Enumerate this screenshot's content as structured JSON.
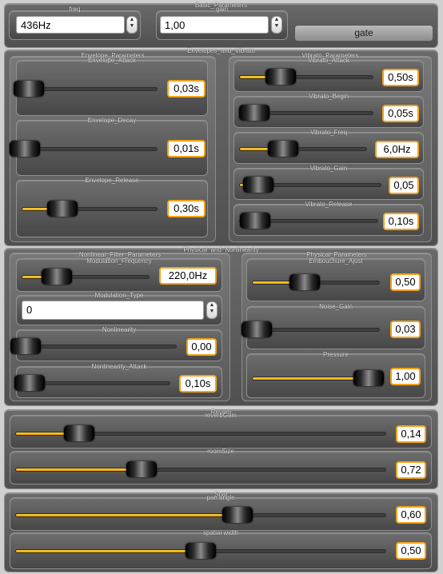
{
  "basic": {
    "title": "Basic_Parameters",
    "freq": {
      "label": "freq",
      "value": "436Hz"
    },
    "gain": {
      "label": "gain",
      "value": "1,00"
    },
    "gate_label": "gate"
  },
  "envelopes_vibrato": {
    "title": "Envelopes_and_Vibrato",
    "envelope": {
      "title": "Envelope_Parameters",
      "attack": {
        "label": "Envelope_Attack",
        "value": "0,03s",
        "fill": 0.05
      },
      "decay": {
        "label": "Envelope_Decay",
        "value": "0,01s",
        "fill": 0.02
      },
      "release": {
        "label": "Envelope_Release",
        "value": "0,30s",
        "fill": 0.3
      }
    },
    "vibrato": {
      "title": "Vibrato_Parameters",
      "attack": {
        "label": "Vibrato_Attack",
        "value": "0,50s",
        "fill": 0.31
      },
      "begin": {
        "label": "Vibrato_Begin",
        "value": "0,05s",
        "fill": 0.11
      },
      "freq": {
        "label": "Vibrato_Freq",
        "value": "6,0Hz",
        "fill": 0.34
      },
      "gain": {
        "label": "Vibrato_Gain",
        "value": "0,05",
        "fill": 0.13
      },
      "release": {
        "label": "Vibrato_Release",
        "value": "0,10s",
        "fill": 0.11
      }
    }
  },
  "physical_nonlinearity": {
    "title": "Physical_and_Nonlinearity",
    "nonlinear": {
      "title": "Nonlinear_Filter_Parameters",
      "mod_freq": {
        "label": "Modulation_Frequency",
        "value": "220,0Hz",
        "fill": 0.27
      },
      "mod_type": {
        "label": "Modulation_Type",
        "value": "0"
      },
      "nonlinearity": {
        "label": "Nonlinearity",
        "value": "0,00",
        "fill": 0.02
      },
      "nonlinearity_attack": {
        "label": "Nonlinearity_Attack",
        "value": "0,10s",
        "fill": 0.05
      }
    },
    "physical": {
      "title": "Physical_Parameters",
      "embouchure": {
        "label": "Embouchure_Ajust",
        "value": "0,50",
        "fill": 0.41
      },
      "noise_gain": {
        "label": "Noise_Gain",
        "value": "0,03",
        "fill": 0.03
      },
      "pressure": {
        "label": "Pressure",
        "value": "1,00",
        "fill": 0.92
      }
    }
  },
  "reverb": {
    "title": "Reverb",
    "reverb_gain": {
      "label": "reverbGain",
      "value": "0,14",
      "fill": 0.17
    },
    "room_size": {
      "label": "roomSize",
      "value": "0,72",
      "fill": 0.34
    }
  },
  "spat": {
    "title": "Spat",
    "pan_angle": {
      "label": "pan angle",
      "value": "0,60",
      "fill": 0.6
    },
    "spatial_width": {
      "label": "spatial width",
      "value": "0,50",
      "fill": 0.5
    }
  }
}
